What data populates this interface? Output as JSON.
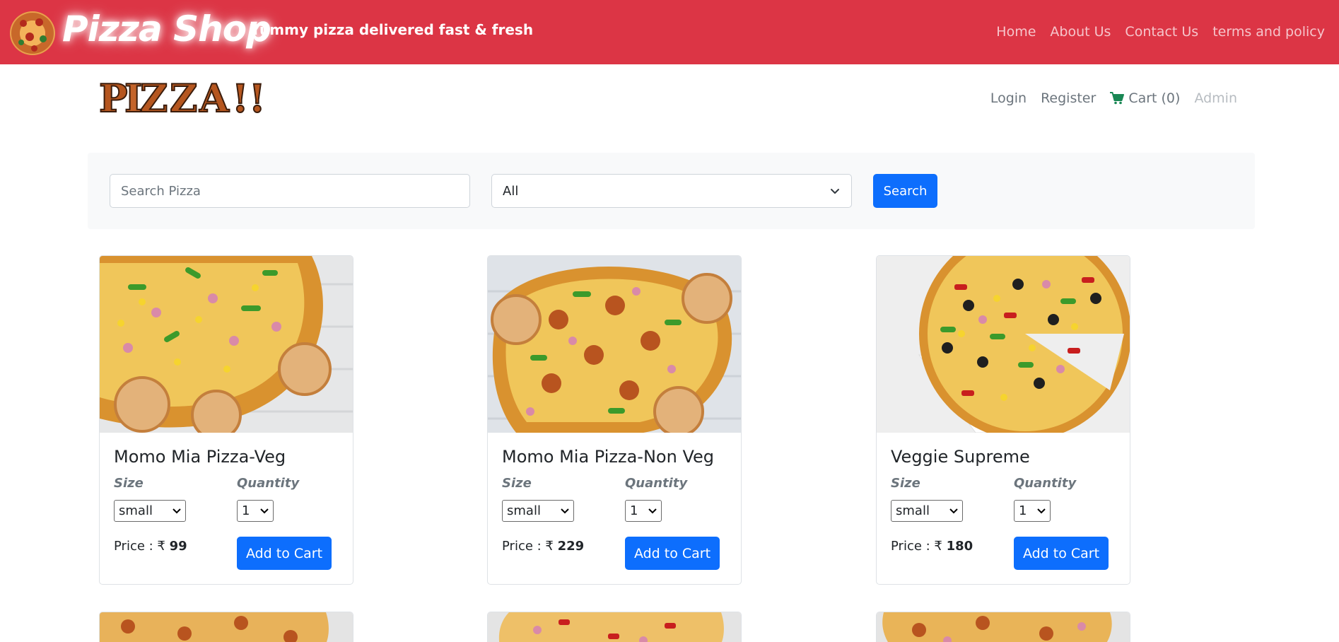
{
  "brand": {
    "title": "Pizza Shop",
    "tagline": "Yummy pizza delivered fast & fresh",
    "logo_icon": "pizza-icon",
    "logo_text": "PIZZA!!"
  },
  "top_nav": [
    "Home",
    "About Us",
    "Contact Us",
    "terms and policy"
  ],
  "header": {
    "login": "Login",
    "register": "Register",
    "cart": "Cart (0)",
    "cart_icon": "shopping-cart-icon",
    "admin": "Admin"
  },
  "search": {
    "placeholder": "Search Pizza",
    "category": "All",
    "button": "Search"
  },
  "labels": {
    "size": "Size",
    "quantity": "Quantity",
    "price_prefix": "Price : ₹",
    "add_to_cart": "Add to Cart"
  },
  "products": [
    {
      "name": "Momo Mia Pizza-Veg",
      "size": "small",
      "quantity": "1",
      "price": "99"
    },
    {
      "name": "Momo Mia Pizza-Non Veg",
      "size": "small",
      "quantity": "1",
      "price": "229"
    },
    {
      "name": "Veggie Supreme",
      "size": "small",
      "quantity": "1",
      "price": "180"
    }
  ],
  "colors": {
    "topbar": "#dc3545",
    "primary": "#0d6efd",
    "cart_icon": "#198754"
  }
}
